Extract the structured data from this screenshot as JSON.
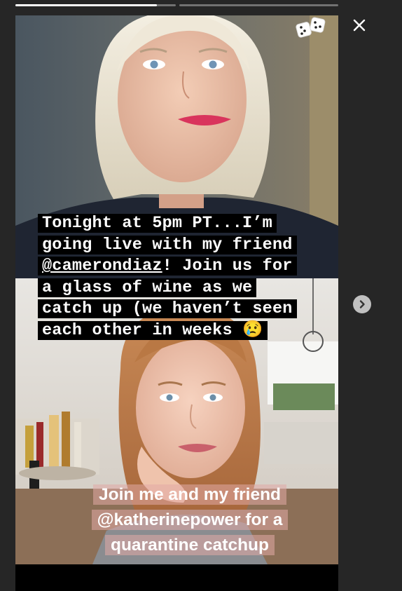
{
  "viewer": {
    "progress": [
      {
        "segment": 1,
        "fill_fraction": 0.88
      },
      {
        "segment": 2,
        "fill_fraction": 0.0
      }
    ],
    "icons": {
      "close": "close-icon",
      "next": "chevron-right-icon",
      "sticker": "dice-sticker-icon"
    }
  },
  "story": {
    "top_caption": {
      "line1": "Tonight at 5pm PT...I’m",
      "line2": "going live with my friend",
      "mention": "@camerondiaz",
      "line3_rest": "! Join us for",
      "line4": "a glass of wine as we",
      "line5": "catch up (we haven’t seen",
      "line6": "each other in weeks 😢"
    },
    "bottom_caption": {
      "line1": "Join me and my friend",
      "line2": "@katherinepower for a",
      "line3": "quarantine catchup"
    }
  },
  "colors": {
    "background": "#262626",
    "caption_highlight": "#000000",
    "bottom_highlight": "#e1aaa5"
  }
}
